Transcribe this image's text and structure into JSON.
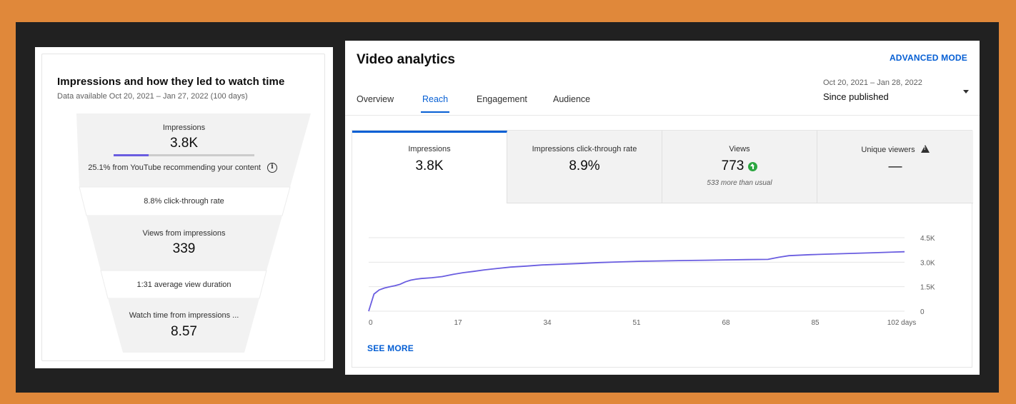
{
  "funnel": {
    "title": "Impressions and how they led to watch time",
    "subtitle": "Data available Oct 20, 2021 – Jan 27, 2022 (100 days)",
    "impressions_label": "Impressions",
    "impressions_value": "3.8K",
    "recommend_fraction": 0.251,
    "recommend_text": "25.1% from YouTube recommending your content",
    "info_icon": "info-icon",
    "ctr_text": "8.8% click-through rate",
    "views_label": "Views from impressions",
    "views_value": "339",
    "avd_text": "1:31 average view duration",
    "watch_label": "Watch time from impressions ...",
    "watch_value": "8.57"
  },
  "analytics": {
    "title": "Video analytics",
    "advanced_mode": "ADVANCED MODE",
    "tabs": [
      {
        "label": "Overview",
        "active": false
      },
      {
        "label": "Reach",
        "active": true
      },
      {
        "label": "Engagement",
        "active": false
      },
      {
        "label": "Audience",
        "active": false
      }
    ],
    "date_range": "Oct 20, 2021 – Jan 28, 2022",
    "date_preset": "Since published",
    "accent_color": "#065fd4",
    "metrics": [
      {
        "label": "Impressions",
        "value": "3.8K",
        "note": "",
        "active": true
      },
      {
        "label": "Impressions click-through rate",
        "value": "8.9%",
        "note": "",
        "active": false
      },
      {
        "label": "Views",
        "value": "773",
        "note": "533 more than usual",
        "icon": "arrow-up-circle-icon",
        "icon_color": "#2ba640",
        "active": false
      },
      {
        "label": "Unique viewers",
        "value": "—",
        "note": "",
        "icon": "warning-icon",
        "active": false
      }
    ],
    "see_more": "SEE MORE"
  },
  "chart_data": {
    "type": "line",
    "series": [
      {
        "line_color": "#6a5de0",
        "x": [
          0,
          1,
          2,
          3,
          4,
          5,
          6,
          7,
          8,
          9,
          10,
          12,
          14,
          16,
          18,
          20,
          22,
          24,
          27,
          30,
          33,
          36,
          40,
          44,
          48,
          52,
          56,
          60,
          64,
          68,
          72,
          76,
          78,
          80,
          84,
          88,
          92,
          96,
          100,
          102
        ],
        "y": [
          0,
          1050,
          1300,
          1420,
          1500,
          1560,
          1650,
          1800,
          1900,
          1960,
          2000,
          2050,
          2120,
          2250,
          2360,
          2440,
          2530,
          2600,
          2700,
          2760,
          2830,
          2870,
          2920,
          2980,
          3020,
          3060,
          3080,
          3100,
          3120,
          3140,
          3160,
          3170,
          3300,
          3400,
          3460,
          3500,
          3540,
          3580,
          3620,
          3640
        ]
      }
    ],
    "x_ticks": [
      "0",
      "17",
      "34",
      "51",
      "68",
      "85",
      "102 days"
    ],
    "x_tick_values": [
      0,
      17,
      34,
      51,
      68,
      85,
      102
    ],
    "y_ticks": [
      "0",
      "1.5K",
      "3.0K",
      "4.5K"
    ],
    "y_tick_values": [
      0,
      1500,
      3000,
      4500
    ],
    "xlim": [
      0,
      102
    ],
    "ylim": [
      0,
      4500
    ],
    "grid": true
  }
}
